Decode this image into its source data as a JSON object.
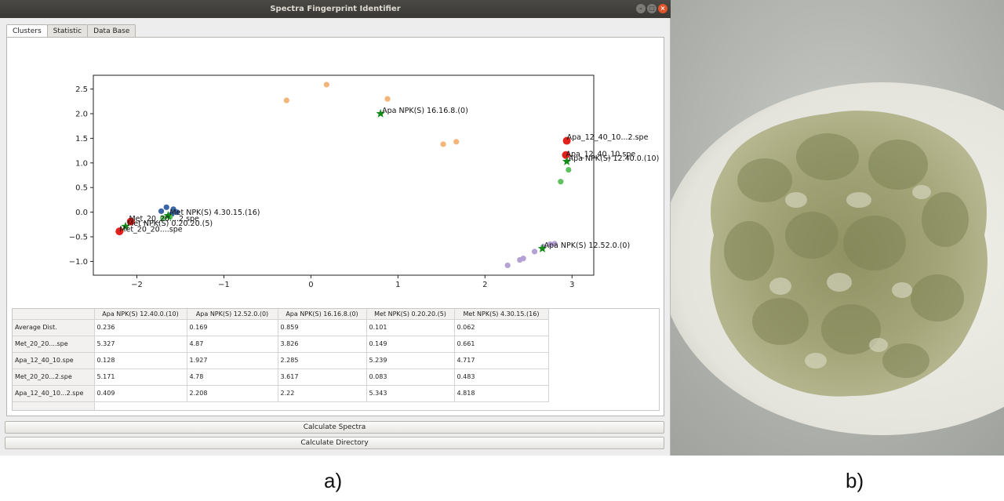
{
  "window": {
    "title": "Spectra Fingerprint Identifier",
    "buttons": [
      "minimize-icon",
      "maximize-icon",
      "close-icon"
    ],
    "min_glyph": "–",
    "max_glyph": "□",
    "close_glyph": "×"
  },
  "tabs": [
    {
      "label": "Clusters",
      "active": true
    },
    {
      "label": "Statistic",
      "active": false
    },
    {
      "label": "Data Base",
      "active": false
    }
  ],
  "chart_data": {
    "type": "scatter",
    "xlim": [
      -2.5,
      3.25
    ],
    "ylim": [
      -1.28,
      2.78
    ],
    "x_ticks": [
      -2,
      -1,
      0,
      1,
      2,
      3
    ],
    "x_tick_labels": [
      "−2",
      "−1",
      "0",
      "1",
      "2",
      "3"
    ],
    "y_ticks": [
      -1.0,
      -0.5,
      0.0,
      0.5,
      1.0,
      1.5,
      2.0,
      2.5
    ],
    "y_tick_labels": [
      "−1.0",
      "−0.5",
      "0.0",
      "0.5",
      "1.0",
      "1.5",
      "2.0",
      "2.5"
    ],
    "grid": false,
    "colors": {
      "blue": "#3a66a8",
      "orange": "#f4b57a",
      "green": "#5fc05f",
      "purple": "#b5a2d4",
      "red": "#e3201b",
      "star": "#118a17"
    },
    "series": [
      {
        "color": "#3a66a8",
        "points": [
          [
            -1.66,
            0.1
          ],
          [
            -1.58,
            0.06
          ],
          [
            -1.54,
            0.0
          ],
          [
            -1.72,
            0.02
          ],
          [
            -1.6,
            -0.04
          ]
        ]
      },
      {
        "color": "#f4b57a",
        "points": [
          [
            -0.28,
            2.27
          ],
          [
            0.18,
            2.59
          ],
          [
            0.88,
            2.3
          ],
          [
            1.52,
            1.38
          ],
          [
            1.67,
            1.43
          ],
          [
            -2.18,
            -0.37
          ]
        ]
      },
      {
        "color": "#5fc05f",
        "points": [
          [
            2.96,
            0.86
          ],
          [
            2.87,
            0.62
          ],
          [
            -1.62,
            -0.1
          ],
          [
            -1.7,
            -0.12
          ]
        ]
      },
      {
        "color": "#b5a2d4",
        "points": [
          [
            2.26,
            -1.08
          ],
          [
            2.4,
            -0.97
          ],
          [
            2.44,
            -0.94
          ],
          [
            2.57,
            -0.8
          ],
          [
            2.67,
            -0.7
          ],
          [
            2.75,
            -0.65
          ],
          [
            2.8,
            -0.64
          ]
        ]
      }
    ],
    "red_markers": [
      [
        2.94,
        1.45
      ],
      [
        2.93,
        1.16
      ],
      [
        -2.07,
        -0.19
      ],
      [
        -2.2,
        -0.39
      ]
    ],
    "centroids": [
      {
        "x": 0.8,
        "y": 2.0,
        "label": "Apa NPK(S) 16.16.8.(0)"
      },
      {
        "x": 2.94,
        "y": 1.03,
        "label": "Apa NPK(S) 12.40.0.(10)"
      },
      {
        "x": 2.66,
        "y": -0.74,
        "label": "Apa NPK(S) 12.52.0.(0)"
      },
      {
        "x": -1.64,
        "y": -0.07,
        "label": "Met NPK(S) 4.30.15.(16)"
      },
      {
        "x": -2.13,
        "y": -0.29,
        "label": "Met NPK(S) 0.20.20.(5)"
      }
    ],
    "point_labels": [
      {
        "x": 2.94,
        "y": 1.52,
        "label": "Apa_12_40_10...2.spe"
      },
      {
        "x": 2.93,
        "y": 1.18,
        "label": "Apa_12_40_10.spe"
      },
      {
        "x": -2.09,
        "y": -0.13,
        "label": "Met_20_20....2.spe"
      },
      {
        "x": -2.2,
        "y": -0.35,
        "label": "Met_20_20....spe"
      }
    ]
  },
  "table": {
    "columns": [
      "",
      "Apa NPK(S) 12.40.0.(10)",
      "Apa NPK(S) 12.52.0.(0)",
      "Apa NPK(S) 16.16.8.(0)",
      "Met NPK(S) 0.20.20.(5)",
      "Met NPK(S) 4.30.15.(16)"
    ],
    "rows": [
      {
        "label": "Average Dist.",
        "values": [
          "0.236",
          "0.169",
          "0.859",
          "0.101",
          "0.062"
        ]
      },
      {
        "label": "Met_20_20....spe",
        "values": [
          "5.327",
          "4.87",
          "3.826",
          "0.149",
          "0.661"
        ]
      },
      {
        "label": "Apa_12_40_10.spe",
        "values": [
          "0.128",
          "1.927",
          "2.285",
          "5.239",
          "4.717"
        ]
      },
      {
        "label": "Met_20_20...2.spe",
        "values": [
          "5.171",
          "4.78",
          "3.617",
          "0.083",
          "0.483"
        ]
      },
      {
        "label": "Apa_12_40_10...2.spe",
        "values": [
          "0.409",
          "2.208",
          "2.22",
          "5.343",
          "4.818"
        ]
      }
    ]
  },
  "buttons": {
    "calc_spectra": "Calculate Spectra",
    "calc_directory": "Calculate Directory"
  },
  "captions": {
    "a": "a)",
    "b": "b)"
  }
}
